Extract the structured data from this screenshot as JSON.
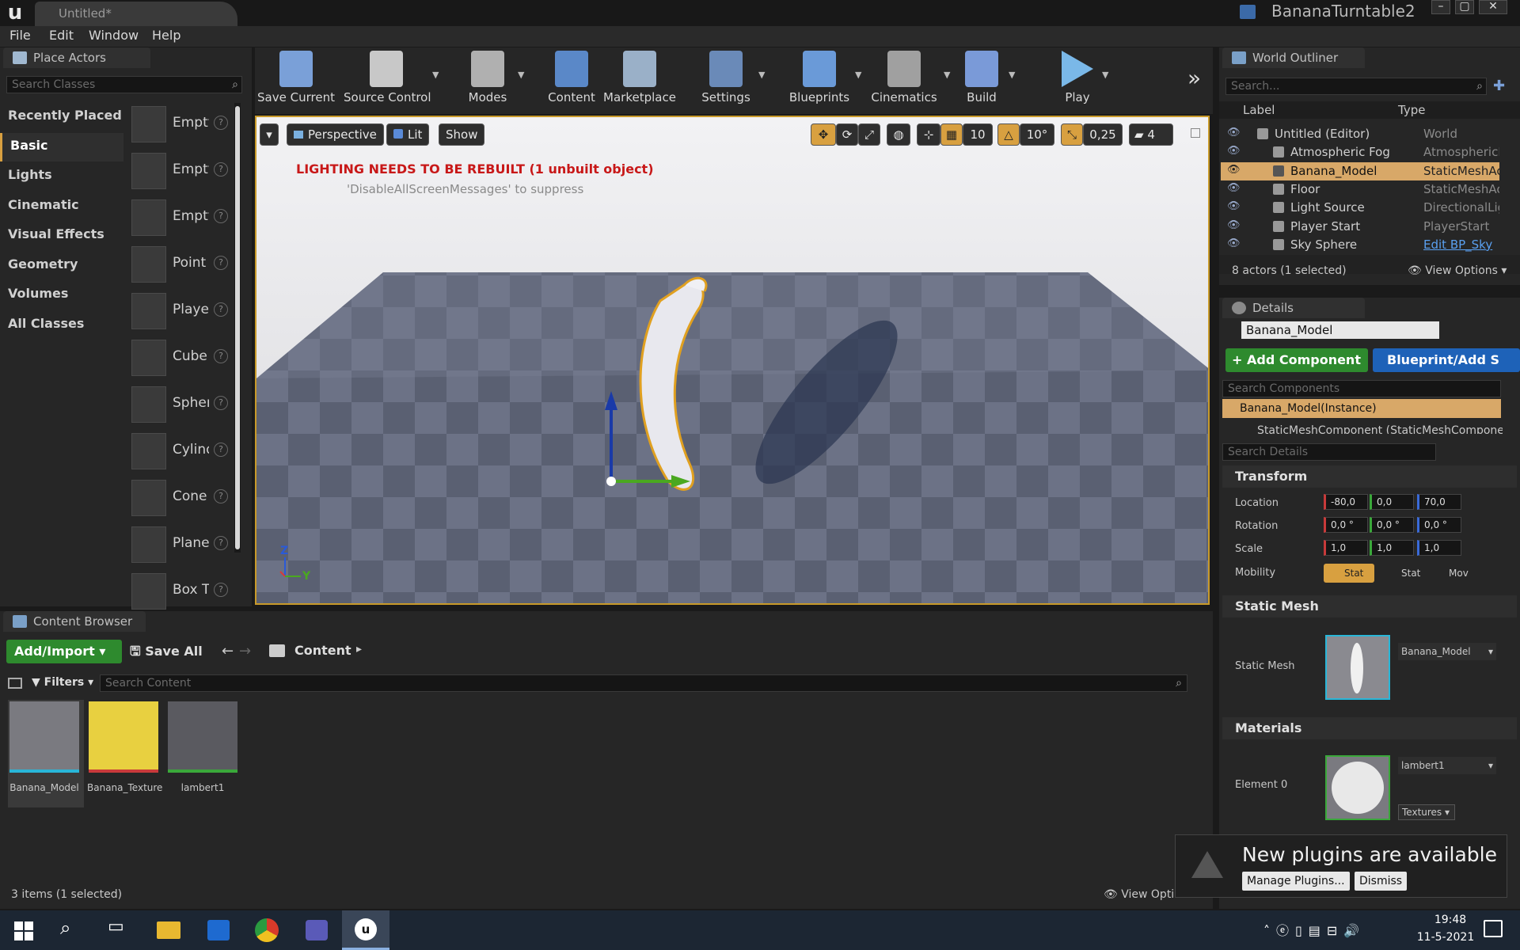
{
  "window": {
    "document_tab": "Untitled*",
    "project_name": "BananaTurntable2",
    "controls": [
      "–",
      "▢",
      "✕"
    ]
  },
  "menubar": {
    "items": [
      "File",
      "Edit",
      "Window",
      "Help"
    ]
  },
  "place_actors": {
    "tab_title": "Place Actors",
    "search_placeholder": "Search Classes",
    "categories": [
      {
        "label": "Recently Placed",
        "active": false
      },
      {
        "label": "Basic",
        "active": true
      },
      {
        "label": "Lights",
        "active": false
      },
      {
        "label": "Cinematic",
        "active": false
      },
      {
        "label": "Visual Effects",
        "active": false
      },
      {
        "label": "Geometry",
        "active": false
      },
      {
        "label": "Volumes",
        "active": false
      },
      {
        "label": "All Classes",
        "active": false
      }
    ],
    "actors": [
      {
        "label": "Empty",
        "icon": "sphere-icon"
      },
      {
        "label": "Empty",
        "icon": "character-icon"
      },
      {
        "label": "Empty",
        "icon": "pawn-icon"
      },
      {
        "label": "Point",
        "icon": "bulb-icon"
      },
      {
        "label": "Player",
        "icon": "player-start-icon"
      },
      {
        "label": "Cube",
        "icon": "cube-icon"
      },
      {
        "label": "Sphere",
        "icon": "sphere-icon"
      },
      {
        "label": "Cylinder",
        "icon": "cylinder-icon"
      },
      {
        "label": "Cone",
        "icon": "cone-icon"
      },
      {
        "label": "Plane",
        "icon": "plane-icon"
      },
      {
        "label": "Box T",
        "icon": "box-trigger-icon"
      }
    ],
    "help_glyph": "?"
  },
  "toolbar": {
    "buttons": [
      {
        "label": "Save Current",
        "icon": "save-icon",
        "has_dropdown": false
      },
      {
        "label": "Source Control",
        "icon": "source-control-icon",
        "has_dropdown": true
      },
      {
        "label": "Modes",
        "icon": "modes-icon",
        "has_dropdown": true
      },
      {
        "label": "Content",
        "icon": "content-icon",
        "has_dropdown": false
      },
      {
        "label": "Marketplace",
        "icon": "marketplace-icon",
        "has_dropdown": false
      },
      {
        "label": "Settings",
        "icon": "settings-icon",
        "has_dropdown": true
      },
      {
        "label": "Blueprints",
        "icon": "blueprints-icon",
        "has_dropdown": true
      },
      {
        "label": "Cinematics",
        "icon": "cinematics-icon",
        "has_dropdown": true
      },
      {
        "label": "Build",
        "icon": "build-icon",
        "has_dropdown": true
      },
      {
        "label": "Play",
        "icon": "play-icon",
        "has_dropdown": true
      }
    ],
    "overflow": "»"
  },
  "viewport": {
    "perspective_label": "Perspective",
    "lit_label": "Lit",
    "show_label": "Show",
    "grid_snap": "10",
    "rotation_snap": "10°",
    "scale_snap": "0,25",
    "camera_speed": "4",
    "warning_text": "LIGHTING NEEDS TO BE REBUILT (1 unbuilt object)",
    "suppress_text": "'DisableAllScreenMessages' to suppress",
    "axis_z": "Z",
    "axis_y": "Y"
  },
  "world_outliner": {
    "tab_title": "World Outliner",
    "search_placeholder": "Search...",
    "col_label": "Label",
    "col_type": "Type",
    "rows": [
      {
        "label": "Untitled (Editor)",
        "type": "World",
        "selected": false,
        "indent": 0,
        "icon": "world-icon"
      },
      {
        "label": "Atmospheric Fog",
        "type": "AtmosphericF",
        "selected": false,
        "indent": 1,
        "icon": "fog-icon"
      },
      {
        "label": "Banana_Model",
        "type": "StaticMeshAc",
        "selected": true,
        "indent": 1,
        "icon": "static-mesh-icon"
      },
      {
        "label": "Floor",
        "type": "StaticMeshAc",
        "selected": false,
        "indent": 1,
        "icon": "static-mesh-icon"
      },
      {
        "label": "Light Source",
        "type": "DirectionalLig",
        "selected": false,
        "indent": 1,
        "icon": "light-icon"
      },
      {
        "label": "Player Start",
        "type": "PlayerStart",
        "selected": false,
        "indent": 1,
        "icon": "player-start-icon"
      },
      {
        "label": "Sky Sphere",
        "type": "Edit BP_Sky",
        "selected": false,
        "indent": 1,
        "icon": "sky-sphere-icon",
        "type_is_link": true
      }
    ],
    "status": "8 actors (1 selected)",
    "view_options": "View Options"
  },
  "details": {
    "tab_title": "Details",
    "actor_name": "Banana_Model",
    "add_component": "+ Add Component",
    "blueprint": "Blueprint/Add S",
    "search_components_placeholder": "Search Components",
    "component_root": "Banana_Model(Instance)",
    "component_child": "StaticMeshComponent (StaticMeshCompone",
    "search_details_placeholder": "Search Details",
    "transform": {
      "header": "Transform",
      "location_label": "Location",
      "location": [
        "-80,0",
        "0,0",
        "70,0"
      ],
      "rotation_label": "Rotation",
      "rotation": [
        "0,0 °",
        "0,0 °",
        "0,0 °"
      ],
      "scale_label": "Scale",
      "scale": [
        "1,0",
        "1,0",
        "1,0"
      ],
      "mobility_label": "Mobility",
      "mobility_options": [
        "Stat",
        "Stat",
        "Mov"
      ]
    },
    "static_mesh": {
      "header": "Static Mesh",
      "label": "Static Mesh",
      "value": "Banana_Model"
    },
    "materials": {
      "header": "Materials",
      "element_label": "Element 0",
      "value": "lambert1",
      "textures": "Textures"
    }
  },
  "content_browser": {
    "tab_title": "Content Browser",
    "add_import": "Add/Import",
    "save_all": "Save All",
    "path": "Content",
    "filters": "Filters",
    "search_placeholder": "Search Content",
    "assets": [
      {
        "label": "Banana_Model",
        "selected": true,
        "accent": "#29b6d8"
      },
      {
        "label": "Banana_Texture",
        "selected": false,
        "accent": "#c83a3a"
      },
      {
        "label": "lambert1",
        "selected": false,
        "accent": "#3aa83a"
      }
    ],
    "status": "3 items (1 selected)",
    "view_options": "View Opti"
  },
  "toast": {
    "title": "New plugins are available",
    "manage": "Manage Plugins...",
    "dismiss": "Dismiss"
  },
  "taskbar": {
    "time": "19:48",
    "date": "11-5-2021"
  },
  "colors": {
    "accent": "#d8a040",
    "selection": "#d8a868",
    "viewport_border": "#c89a2a",
    "warning": "#c81818",
    "green_button": "#2e8a2e",
    "blue_button": "#1e62b8"
  }
}
